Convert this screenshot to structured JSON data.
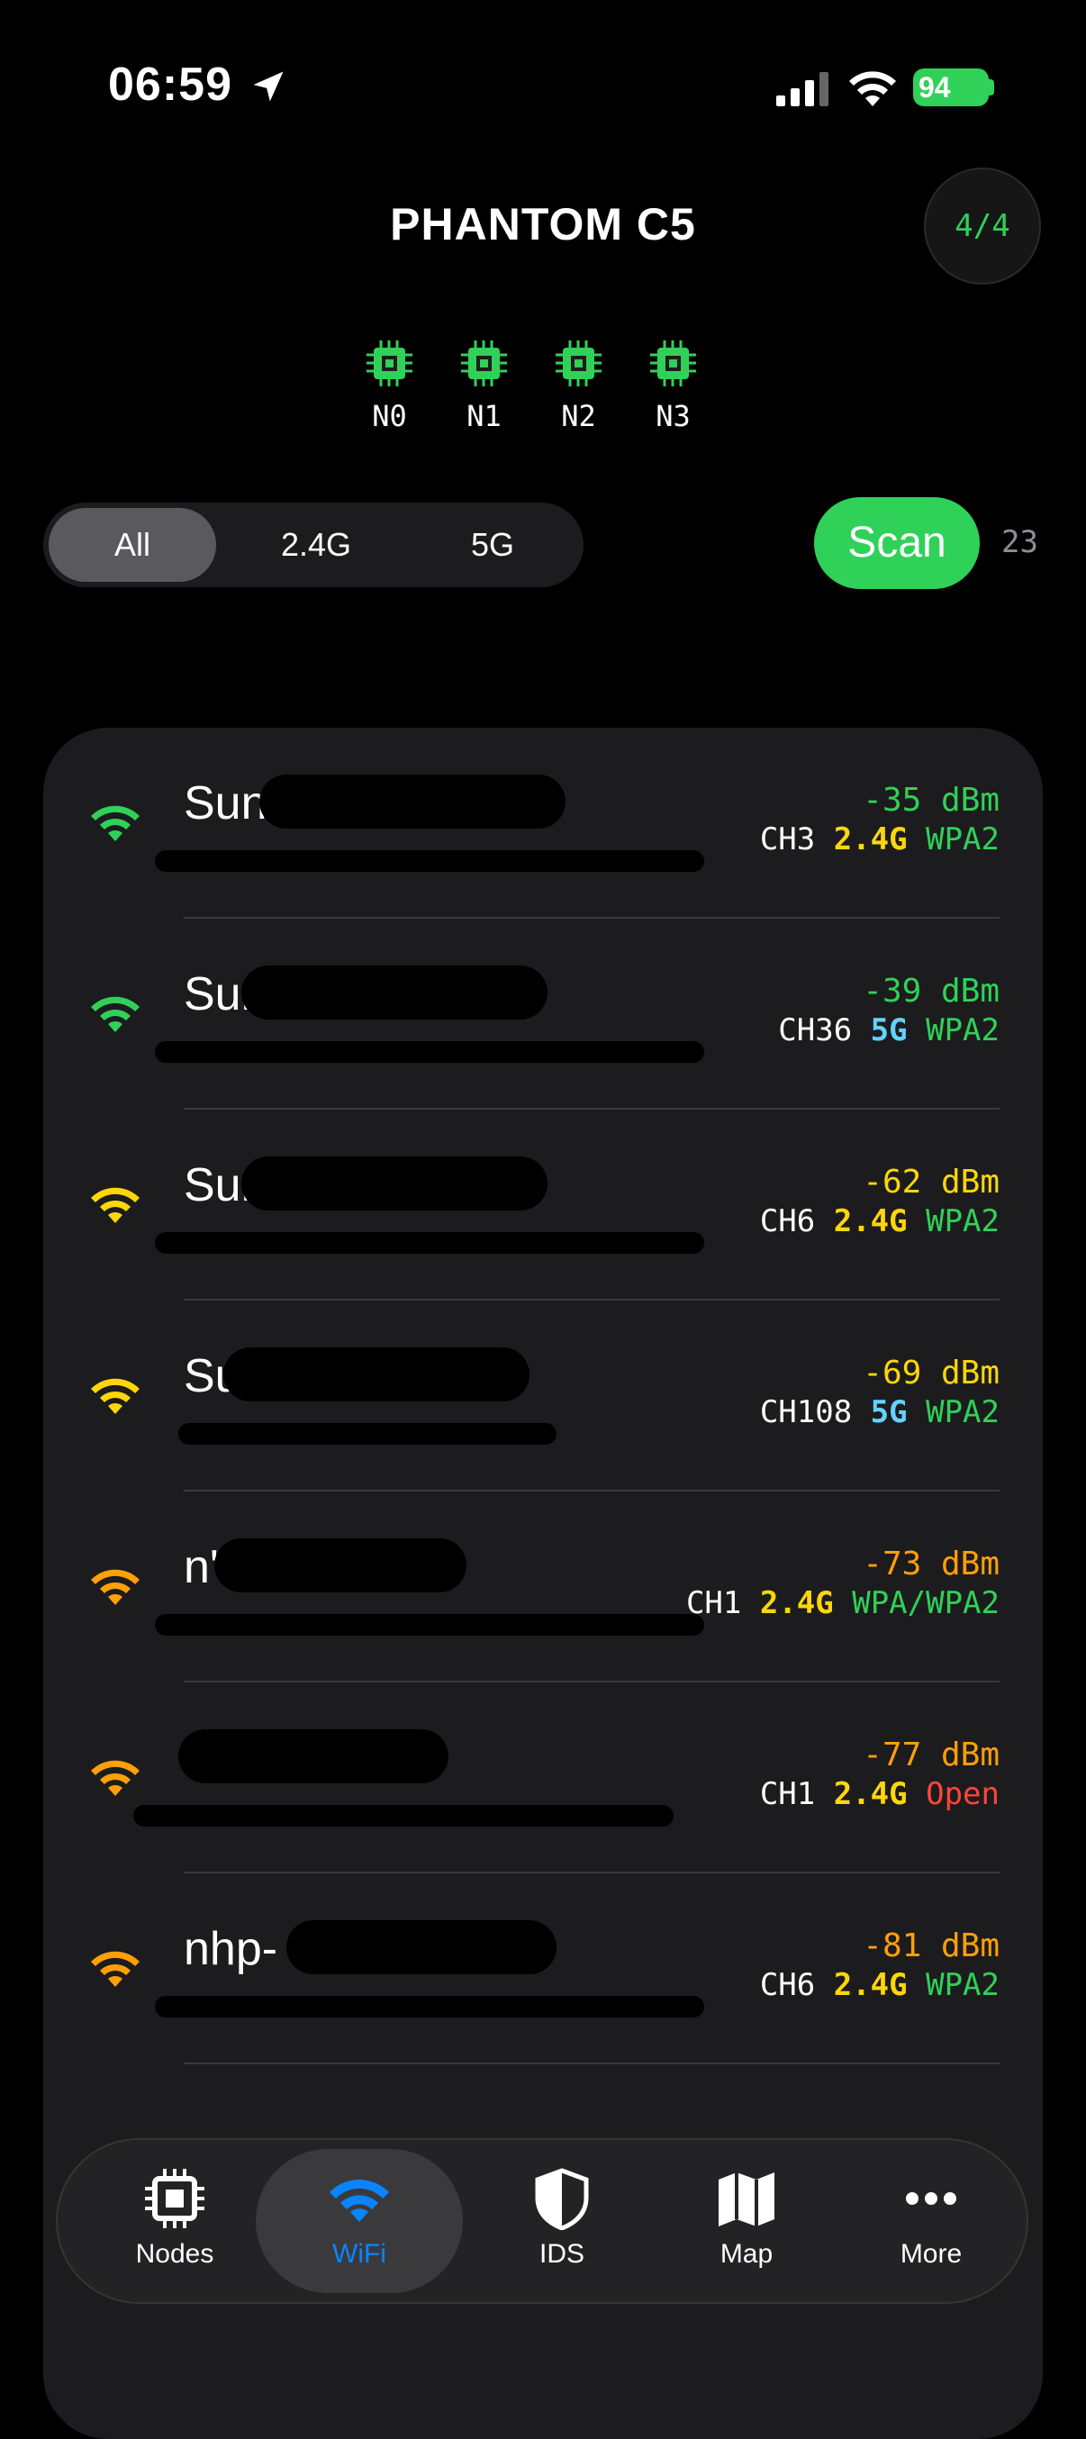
{
  "status_bar": {
    "time": "06:59",
    "battery": "94"
  },
  "header": {
    "title": "PHANTOM C5",
    "node_count": "4/4"
  },
  "nodes": [
    "N0",
    "N1",
    "N2",
    "N3"
  ],
  "filters": {
    "options": [
      "All",
      "2.4G",
      "5G"
    ],
    "selected": "All"
  },
  "scan": {
    "label": "Scan",
    "count": "23"
  },
  "networks": [
    {
      "ssid": "Sunri",
      "dbm": "-35 dBm",
      "channel": "CH3",
      "band": "2.4G",
      "security": "WPA2",
      "strength_color": "#30d158"
    },
    {
      "ssid": "Sunr",
      "dbm": "-39 dBm",
      "channel": "CH36",
      "band": "5G",
      "security": "WPA2",
      "strength_color": "#30d158"
    },
    {
      "ssid": "Sunr",
      "dbm": "-62 dBm",
      "channel": "CH6",
      "band": "2.4G",
      "security": "WPA2",
      "strength_color": "#ffd60a"
    },
    {
      "ssid": "Sur",
      "dbm": "-69 dBm",
      "channel": "CH108",
      "band": "5G",
      "security": "WPA2",
      "strength_color": "#ffd60a"
    },
    {
      "ssid": "n'",
      "dbm": "-73 dBm",
      "channel": "CH1",
      "band": "2.4G",
      "security": "WPA/WPA2",
      "strength_color": "#ff9f0a"
    },
    {
      "ssid": "",
      "dbm": "-77 dBm",
      "channel": "CH1",
      "band": "2.4G",
      "security": "Open",
      "strength_color": "#ff9f0a"
    },
    {
      "ssid": "nhp-",
      "dbm": "-81 dBm",
      "channel": "CH6",
      "band": "2.4G",
      "security": "WPA2",
      "strength_color": "#ff9f0a"
    }
  ],
  "tabs": [
    {
      "label": "Nodes",
      "icon": "chip-icon"
    },
    {
      "label": "WiFi",
      "icon": "wifi-icon"
    },
    {
      "label": "IDS",
      "icon": "shield-icon"
    },
    {
      "label": "Map",
      "icon": "map-icon"
    },
    {
      "label": "More",
      "icon": "more-icon"
    }
  ],
  "colors": {
    "accent_green": "#30d158",
    "active_tab": "#0a84ff",
    "band_24": "#ffd60a",
    "band_5": "#64d2ff",
    "open": "#ff453a"
  }
}
